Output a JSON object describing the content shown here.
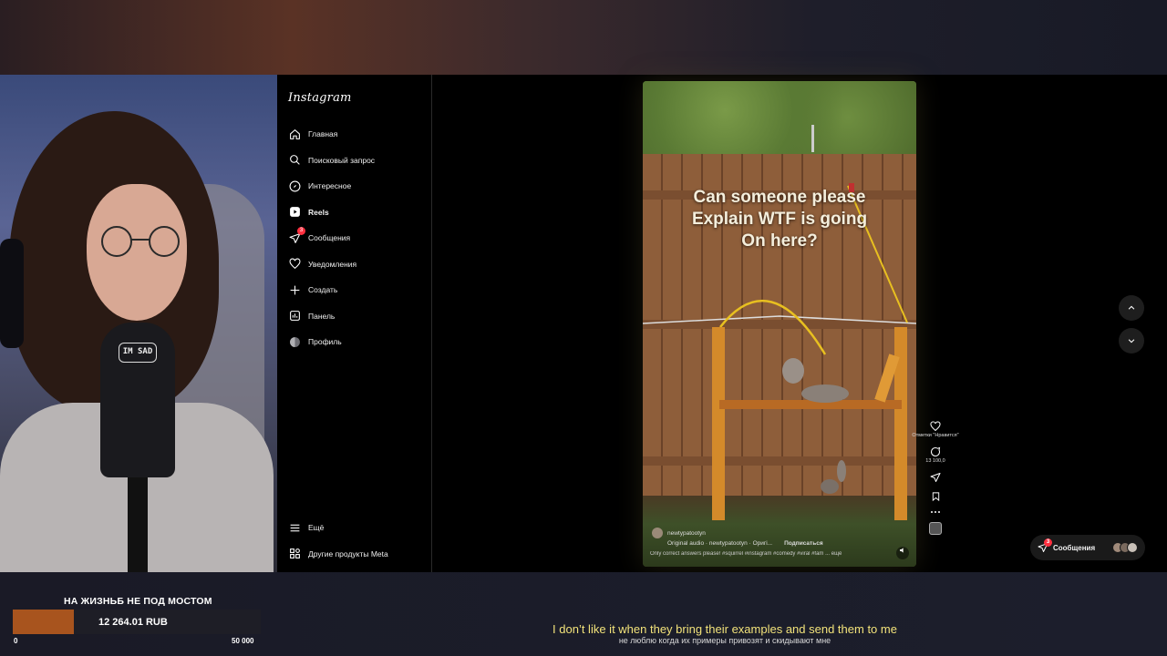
{
  "instagram": {
    "logo": "Instagram",
    "nav": [
      {
        "label": "Главная",
        "icon": "home-icon"
      },
      {
        "label": "Поисковый запрос",
        "icon": "search-icon"
      },
      {
        "label": "Интересное",
        "icon": "compass-icon"
      },
      {
        "label": "Reels",
        "icon": "reels-icon",
        "active": true
      },
      {
        "label": "Сообщения",
        "icon": "messenger-icon",
        "badge": "3"
      },
      {
        "label": "Уведомления",
        "icon": "heart-icon"
      },
      {
        "label": "Создать",
        "icon": "plus-icon"
      },
      {
        "label": "Панель",
        "icon": "dashboard-icon"
      },
      {
        "label": "Профиль",
        "icon": "profile-avatar-icon"
      }
    ],
    "nav_bottom": [
      {
        "label": "Ещё",
        "icon": "menu-icon"
      },
      {
        "label": "Другие продукты Meta",
        "icon": "meta-products-icon"
      }
    ],
    "reel": {
      "caption": "Can someone please\nExplain WTF is going\nOn here?",
      "username": "newtypatootyn",
      "audio": "Original audio · newtypatootyn · Оригі...",
      "follow_label": "Подписаться",
      "description": "Only correct answers please! #squirrel #instagram #comedy #viral #fam ... ещё"
    },
    "actions": {
      "like_label": "Отметки \"Нравится\"",
      "comments_count": "13 100,0"
    },
    "messages_pill": {
      "label": "Сообщения",
      "badge": "3"
    }
  },
  "webcam": {
    "mic_sticker": "IM SAD"
  },
  "goal": {
    "title": "НА ЖИЗНЬБ НЕ ПОД МОСТОМ",
    "amount": "12 264.01 RUB",
    "min": "0",
    "max": "50 000",
    "progress": 0.245,
    "fill_color": "#a8541e"
  },
  "subtitles": {
    "en": "I don’t like it when they bring their examples and send them to me",
    "ru": "не люблю когда их примеры привозят и скидывают мне"
  }
}
